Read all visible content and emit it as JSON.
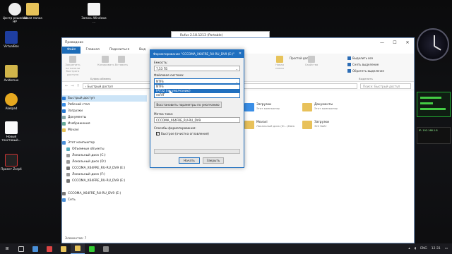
{
  "desktop": {
    "icons": [
      {
        "label": "Центр решений HP"
      },
      {
        "label": "Новая папка"
      },
      {
        "label": "Запись Windows ..."
      },
      {
        "label": "VirtualBox"
      },
      {
        "label": "Avidemux"
      },
      {
        "label": "Akelpad"
      },
      {
        "label": "Новый текстовый..."
      },
      {
        "label": "Проект Zorp4"
      }
    ]
  },
  "rufus_window": {
    "title": "Rufus 2.18.1213 (Portable)"
  },
  "explorer": {
    "title": "Проводник",
    "window_buttons": {
      "minimize": "—",
      "maximize": "☐",
      "close": "✕"
    },
    "tabs": [
      "Файл",
      "Главная",
      "Поделиться",
      "Вид"
    ],
    "ribbon": {
      "pin": "Закрепить на панели быстрого доступа",
      "copy": "Копировать",
      "paste": "Вставить",
      "clipboard_group": "Буфер обмена",
      "new_folder": "Новая папка",
      "properties": "Свойства",
      "select_all": "Выделить все",
      "select_none": "Снять выделение",
      "invert": "Обратить выделение",
      "select_group": "Выделить",
      "easy_access": "Простой доступ"
    },
    "address": {
      "path": "› Быстрый доступ",
      "search_placeholder": "Поиск: Быстрый доступ"
    },
    "nav": [
      {
        "label": "Быстрый доступ",
        "sel": true
      },
      {
        "label": "Рабочий стол"
      },
      {
        "label": "Загрузки"
      },
      {
        "label": "Документы"
      },
      {
        "label": "Изображения"
      },
      {
        "label": "Movavi"
      },
      {
        "label": ""
      },
      {
        "label": "Этот компьютер"
      },
      {
        "label": "Объемные объекты"
      },
      {
        "label": "Локальный диск (C:)"
      },
      {
        "label": "Локальный диск (D:)"
      },
      {
        "label": "CCCOMA_X64FRE_RU-RU_DV9 (E:)"
      },
      {
        "label": "Локальный диск (F:)"
      },
      {
        "label": "CCCOMA_X64FRE_RU-RU_DV9 (E:)"
      },
      {
        "label": ""
      },
      {
        "label": "CCCOMA_X64FRE_RU-RU_DV9 (E:)"
      },
      {
        "label": "Сеть"
      }
    ],
    "tiles": [
      {
        "name": "Загрузки",
        "sub": "Этот компьютер"
      },
      {
        "name": "Документы",
        "sub": "Этот компьютер"
      },
      {
        "name": "Movavi",
        "sub": "Локальный диск (D:...\\Data"
      },
      {
        "name": "Загрузки",
        "sub": "322 байт"
      }
    ],
    "status": "Элементов: 7"
  },
  "format_dialog": {
    "title": "Форматирование \"CCCOMA_X64FRE_RU-RU_DV9 (E:)\"",
    "capacity_label": "Емкость:",
    "capacity_value": "7,53 ГБ",
    "fs_label": "Файловая система:",
    "fs_value": "NTFS",
    "fs_options": [
      "NTFS",
      "FAT32 (по умолчанию)",
      "exFAT"
    ],
    "fs_highlight_index": 1,
    "restore_button": "Восстановить параметры по умолчанию",
    "volume_label": "Метка тома:",
    "volume_value": "CCCOMA_X64FRE_RU-RU_DV9",
    "format_options_label": "Способы форматирования:",
    "quick_format": "Быстрое (очистка оглавления)",
    "quick_format_checked": true,
    "start_button": "Начать",
    "close_button": "Закрыть"
  },
  "widgets": {
    "net_text": "IP: 192.168.1.8"
  },
  "taskbar": {
    "lang": "ENG",
    "time": "12:31"
  }
}
